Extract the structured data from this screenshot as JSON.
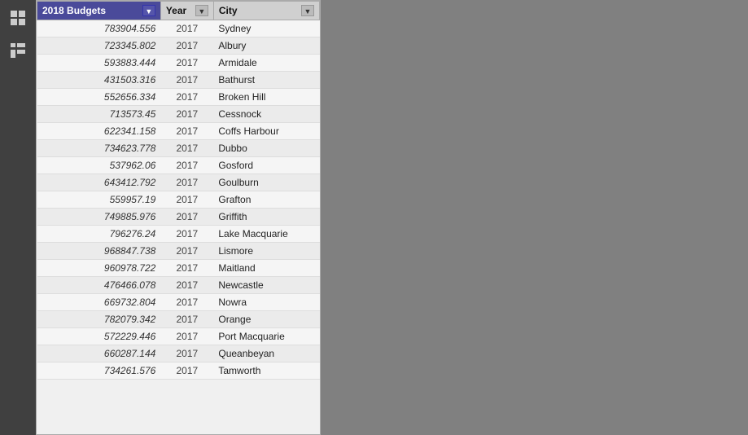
{
  "sidebar": {
    "icons": [
      {
        "name": "grid-icon",
        "symbol": "⊞"
      },
      {
        "name": "hierarchy-icon",
        "symbol": "⊟"
      }
    ]
  },
  "table": {
    "columns": {
      "budget": "2018 Budgets",
      "year": "Year",
      "city": "City"
    },
    "rows": [
      {
        "budget": "783904.556",
        "year": "2017",
        "city": "Sydney"
      },
      {
        "budget": "723345.802",
        "year": "2017",
        "city": "Albury"
      },
      {
        "budget": "593883.444",
        "year": "2017",
        "city": "Armidale"
      },
      {
        "budget": "431503.316",
        "year": "2017",
        "city": "Bathurst"
      },
      {
        "budget": "552656.334",
        "year": "2017",
        "city": "Broken Hill"
      },
      {
        "budget": "713573.45",
        "year": "2017",
        "city": "Cessnock"
      },
      {
        "budget": "622341.158",
        "year": "2017",
        "city": "Coffs Harbour"
      },
      {
        "budget": "734623.778",
        "year": "2017",
        "city": "Dubbo"
      },
      {
        "budget": "537962.06",
        "year": "2017",
        "city": "Gosford"
      },
      {
        "budget": "643412.792",
        "year": "2017",
        "city": "Goulburn"
      },
      {
        "budget": "559957.19",
        "year": "2017",
        "city": "Grafton"
      },
      {
        "budget": "749885.976",
        "year": "2017",
        "city": "Griffith"
      },
      {
        "budget": "796276.24",
        "year": "2017",
        "city": "Lake Macquarie"
      },
      {
        "budget": "968847.738",
        "year": "2017",
        "city": "Lismore"
      },
      {
        "budget": "960978.722",
        "year": "2017",
        "city": "Maitland"
      },
      {
        "budget": "476466.078",
        "year": "2017",
        "city": "Newcastle"
      },
      {
        "budget": "669732.804",
        "year": "2017",
        "city": "Nowra"
      },
      {
        "budget": "782079.342",
        "year": "2017",
        "city": "Orange"
      },
      {
        "budget": "572229.446",
        "year": "2017",
        "city": "Port Macquarie"
      },
      {
        "budget": "660287.144",
        "year": "2017",
        "city": "Queanbeyan"
      },
      {
        "budget": "734261.576",
        "year": "2017",
        "city": "Tamworth"
      }
    ]
  }
}
